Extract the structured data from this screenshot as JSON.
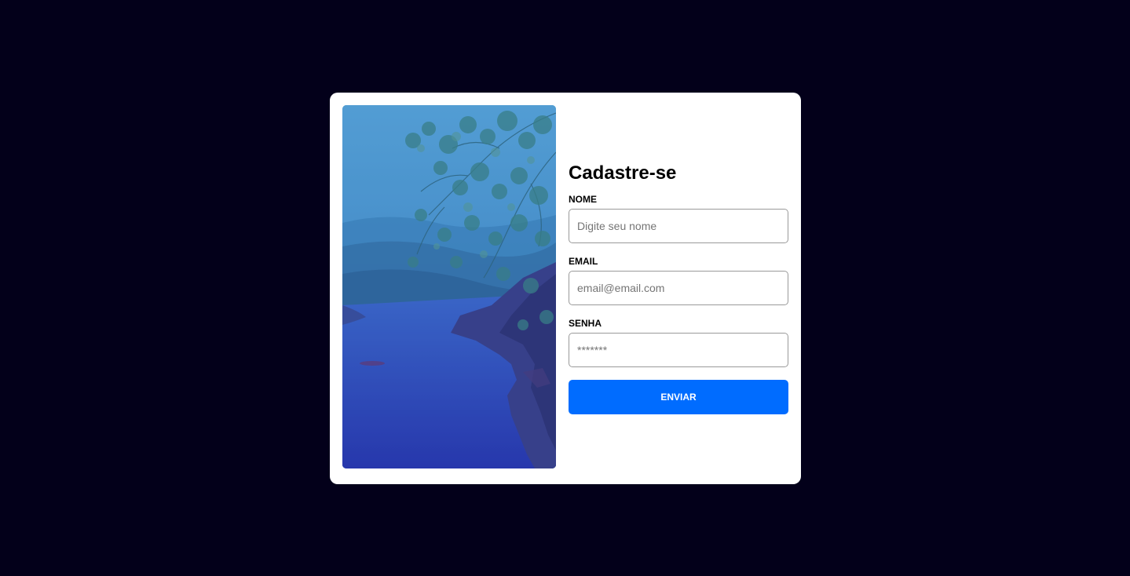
{
  "form": {
    "title": "Cadastre-se",
    "fields": [
      {
        "label": "NOME",
        "placeholder": "Digite seu nome",
        "type": "text"
      },
      {
        "label": "EMAIL",
        "placeholder": "email@email.com",
        "type": "email"
      },
      {
        "label": "SENHA",
        "placeholder": "*******",
        "type": "password"
      }
    ],
    "submit_label": "ENVIAR"
  },
  "colors": {
    "background": "#03001a",
    "card": "#ffffff",
    "button": "#006cff"
  }
}
